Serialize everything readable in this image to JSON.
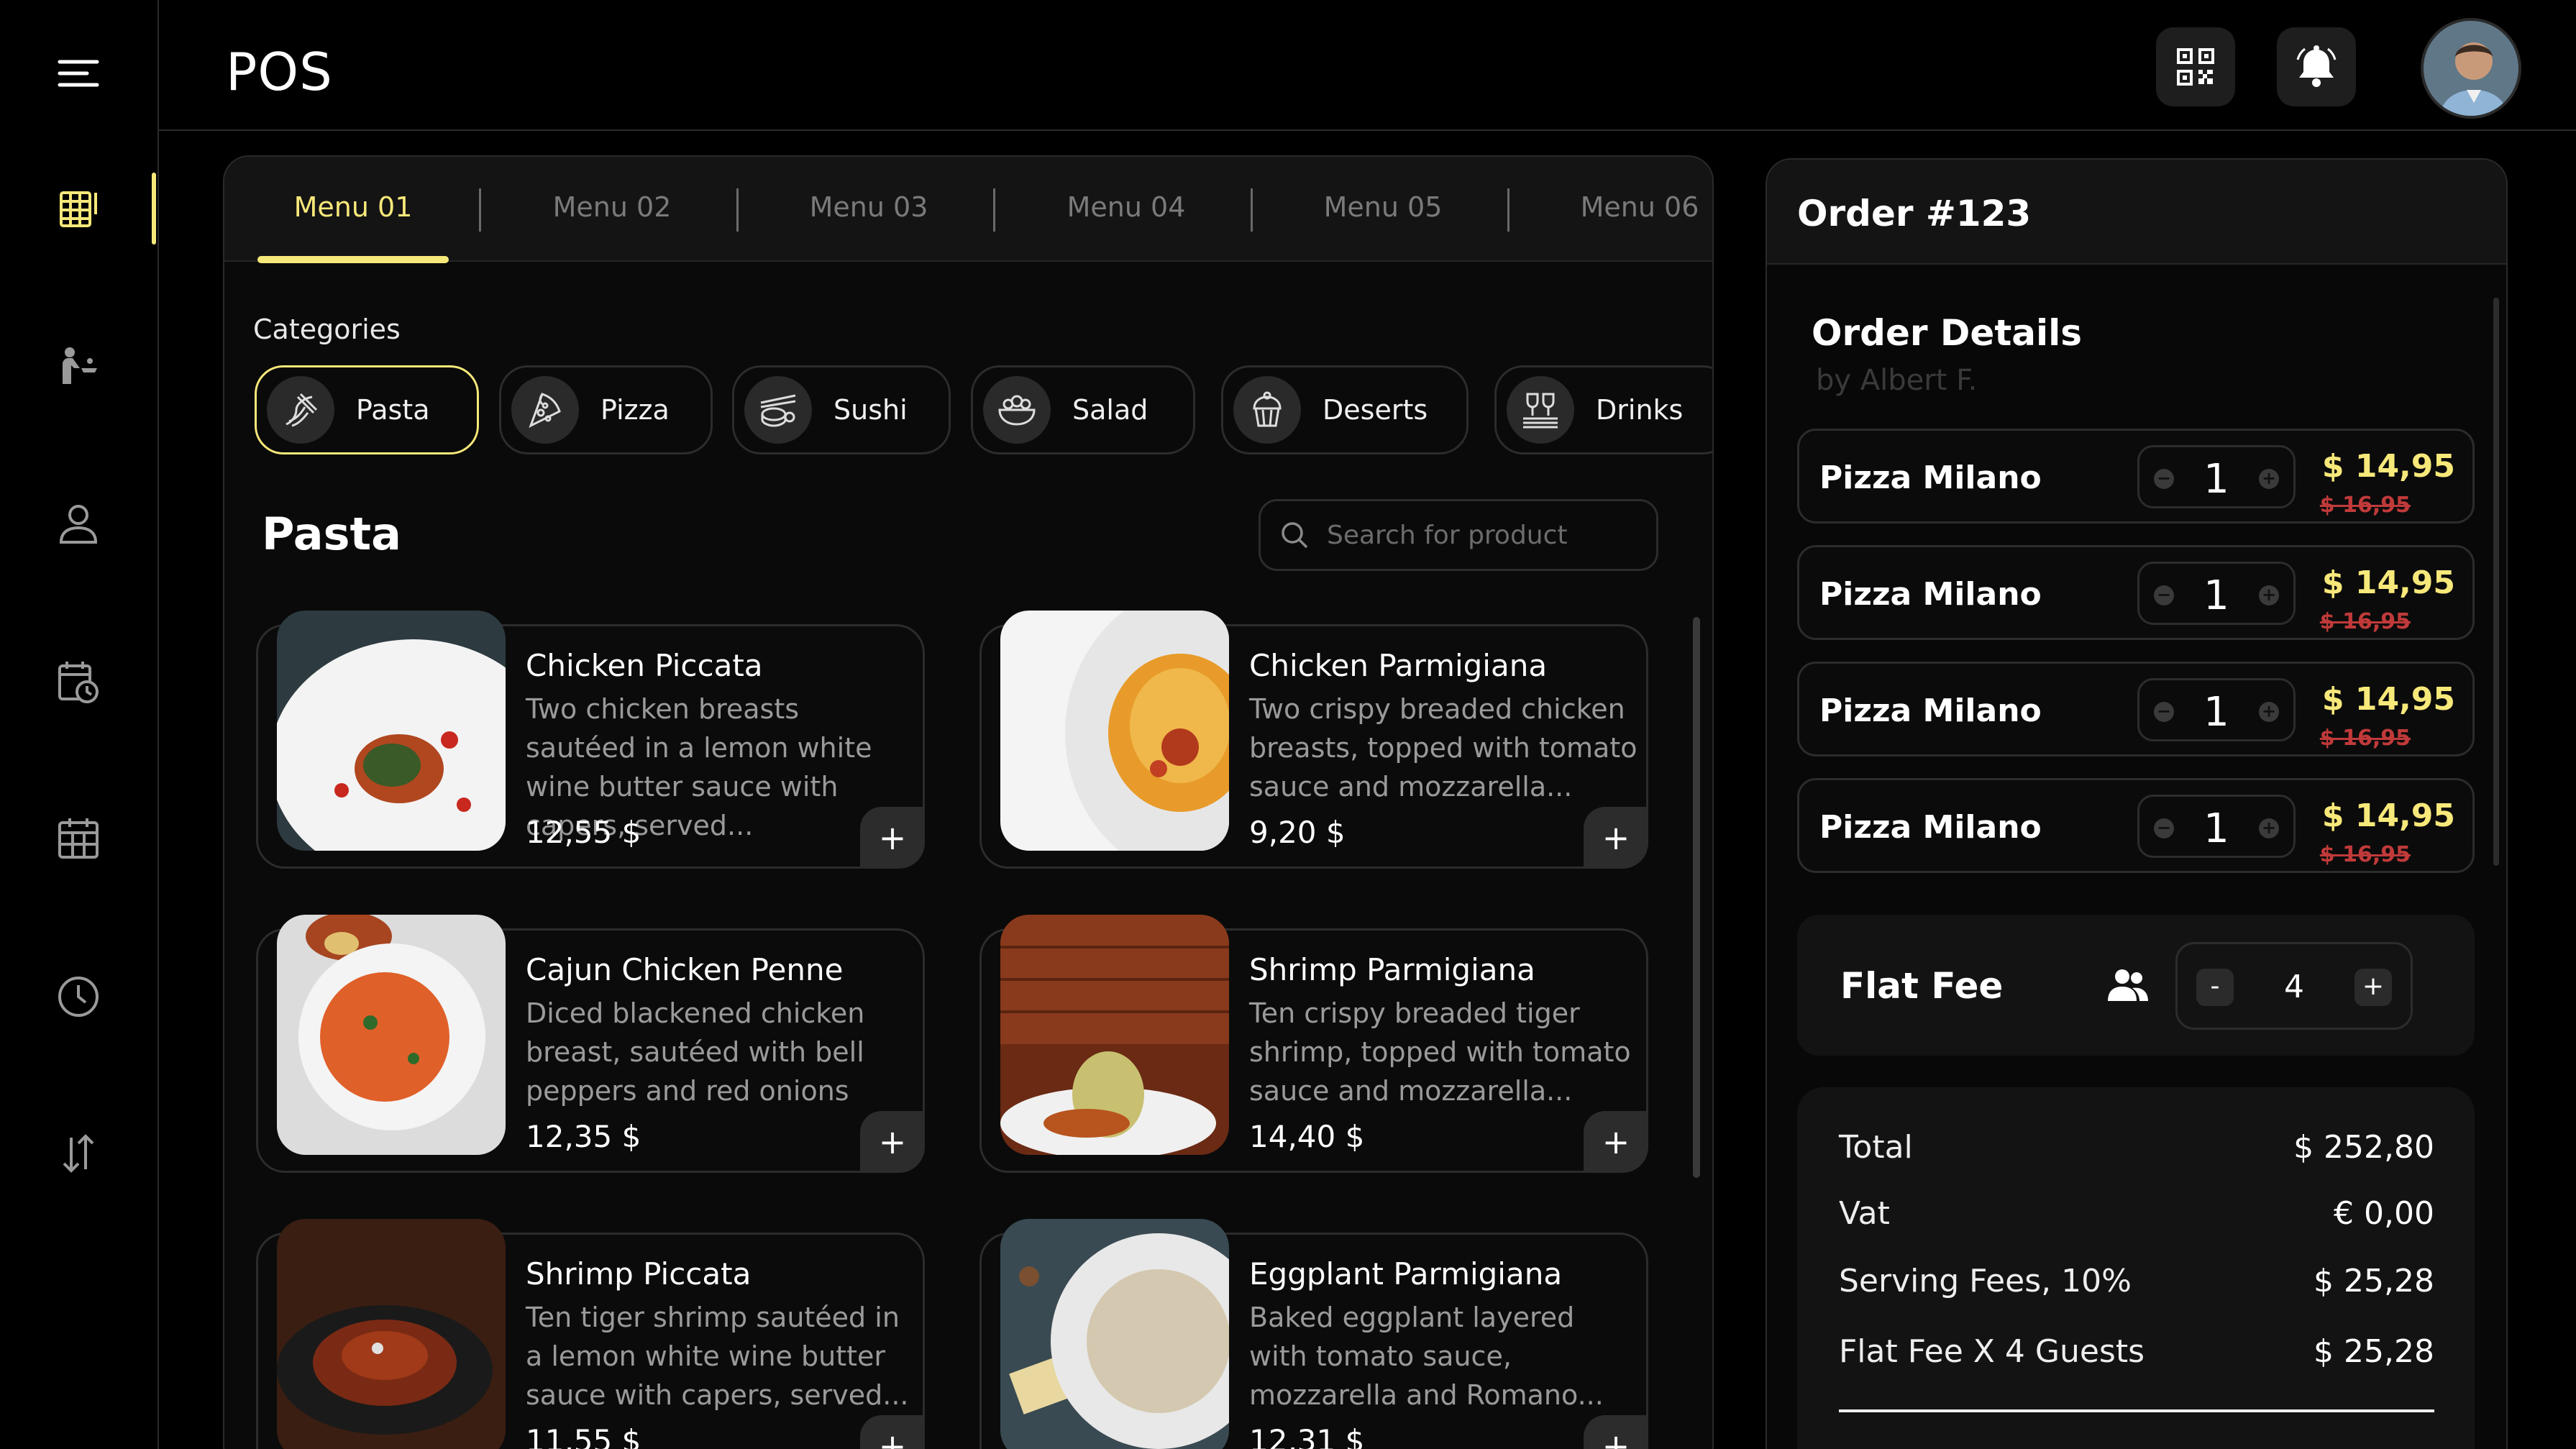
{
  "app": {
    "title": "POS"
  },
  "colors": {
    "accent": "#f7e87a",
    "background": "#000000",
    "card": "#0b0b0b",
    "border": "#2c2c2c",
    "strike": "#c03a3a"
  },
  "sidebar": {
    "items": [
      {
        "name": "menu-grid-icon",
        "active": true
      },
      {
        "name": "waiter-icon"
      },
      {
        "name": "user-icon"
      },
      {
        "name": "calendar-clock-icon"
      },
      {
        "name": "calendar-icon"
      },
      {
        "name": "clock-icon"
      },
      {
        "name": "sort-arrows-icon"
      }
    ]
  },
  "header": {
    "icons": [
      "qr-code-icon",
      "bell-icon",
      "avatar"
    ]
  },
  "tabs": [
    {
      "label": "Menu 01",
      "active": true
    },
    {
      "label": "Menu 02"
    },
    {
      "label": "Menu 03"
    },
    {
      "label": "Menu 04"
    },
    {
      "label": "Menu 05"
    },
    {
      "label": "Menu 06"
    }
  ],
  "categories": {
    "label": "Categories",
    "items": [
      {
        "label": "Pasta",
        "icon": "pasta-icon",
        "active": true
      },
      {
        "label": "Pizza",
        "icon": "pizza-icon"
      },
      {
        "label": "Sushi",
        "icon": "sushi-icon"
      },
      {
        "label": "Salad",
        "icon": "salad-icon"
      },
      {
        "label": "Deserts",
        "icon": "dessert-icon"
      },
      {
        "label": "Drinks",
        "icon": "drinks-icon"
      }
    ]
  },
  "section": {
    "title": "Pasta",
    "search_placeholder": "Search for product"
  },
  "products": [
    {
      "name": "Chicken Piccata",
      "desc": "Two chicken breasts sautéed in a lemon white wine butter sauce with capers, served...",
      "price": "12,55 $"
    },
    {
      "name": "Chicken Parmigiana",
      "desc": "Two crispy breaded chicken breasts, topped with tomato sauce and mozzarella...",
      "price": "9,20  $"
    },
    {
      "name": "Cajun Chicken Penne",
      "desc": "Diced blackened chicken breast, sautéed with bell peppers and red onions",
      "price": "12,35 $"
    },
    {
      "name": "Shrimp Parmigiana",
      "desc": "Ten crispy breaded tiger shrimp, topped with tomato sauce and mozzarella...",
      "price": "14,40 $"
    },
    {
      "name": "Shrimp Piccata",
      "desc": "Ten tiger shrimp sautéed in a lemon white wine butter sauce with capers, served...",
      "price": "11,55  $"
    },
    {
      "name": "Eggplant Parmigiana",
      "desc": "Baked eggplant layered with tomato sauce,  mozzarella and Romano...",
      "price": "12,31  $"
    }
  ],
  "order": {
    "title": "Order #123",
    "details_label": "Order Details",
    "by": "by Albert F.",
    "items": [
      {
        "name": "Pizza Milano",
        "qty": "1",
        "price": "$  14,95",
        "old_price": "$  16,95"
      },
      {
        "name": "Pizza Milano",
        "qty": "1",
        "price": "$  14,95",
        "old_price": "$  16,95"
      },
      {
        "name": "Pizza Milano",
        "qty": "1",
        "price": "$  14,95",
        "old_price": "$  16,95"
      },
      {
        "name": "Pizza Milano",
        "qty": "1",
        "price": "$  14,95",
        "old_price": "$  16,95"
      }
    ],
    "flat_fee": {
      "label": "Flat Fee",
      "guests": "4",
      "minus": "-",
      "plus": "+"
    },
    "totals": [
      {
        "label": "Total",
        "value": "$ 252,80"
      },
      {
        "label": "Vat",
        "value": "€ 0,00"
      },
      {
        "label": "Serving Fees, 10%",
        "value": "$ 25,28"
      },
      {
        "label": "Flat Fee X 4 Guests",
        "value": "$ 25,28"
      }
    ]
  }
}
